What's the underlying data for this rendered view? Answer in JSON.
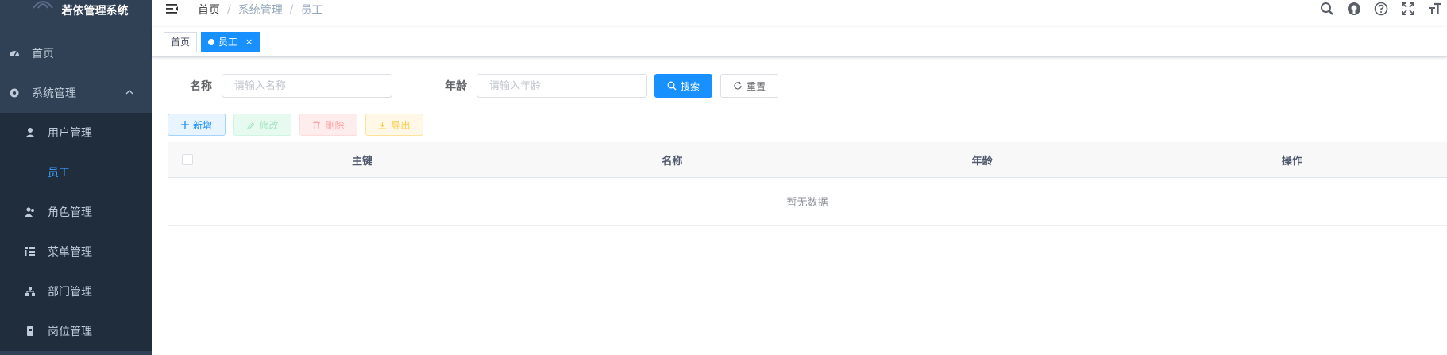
{
  "app": {
    "title": "若依管理系统"
  },
  "sidebar": {
    "items": [
      {
        "label": "首页",
        "icon": "dashboard-icon"
      },
      {
        "label": "系统管理",
        "icon": "system-icon"
      }
    ],
    "sub_items": [
      {
        "label": "用户管理",
        "icon": "user-icon"
      },
      {
        "label": "员工",
        "active": true
      },
      {
        "label": "角色管理",
        "icon": "peoples-icon"
      },
      {
        "label": "菜单管理",
        "icon": "tree-table-icon"
      },
      {
        "label": "部门管理",
        "icon": "tree-icon"
      },
      {
        "label": "岗位管理",
        "icon": "post-icon"
      }
    ]
  },
  "breadcrumb": {
    "home": "首页",
    "parent": "系统管理",
    "current": "员工",
    "sep": "/"
  },
  "tags": {
    "home": "首页",
    "active": "员工",
    "close": "×"
  },
  "search": {
    "name_label": "名称",
    "name_placeholder": "请输入名称",
    "age_label": "年龄",
    "age_placeholder": "请输入年龄",
    "search_button": "搜索",
    "reset_button": "重置"
  },
  "toolbar": {
    "add": "新增",
    "edit": "修改",
    "delete": "删除",
    "export": "导出"
  },
  "table": {
    "columns": [
      "主键",
      "名称",
      "年龄",
      "操作"
    ],
    "empty_text": "暂无数据"
  },
  "colors": {
    "sidebar_bg": "#304156",
    "submenu_bg": "#1f2d3d",
    "primary": "#1890ff",
    "active_text": "#409eff"
  }
}
